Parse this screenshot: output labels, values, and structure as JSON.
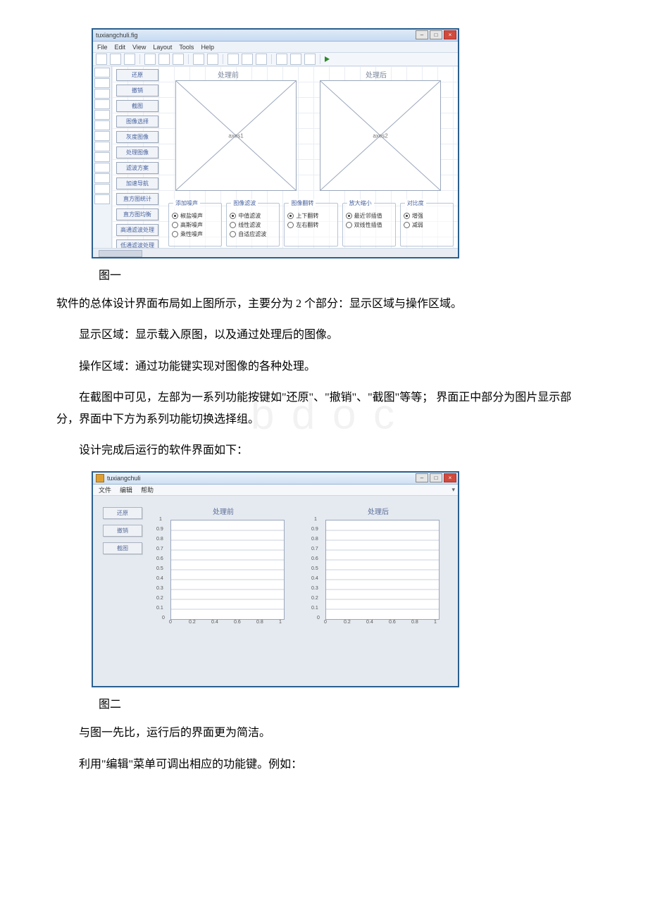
{
  "captions": {
    "fig1": "图一",
    "fig2": "图二"
  },
  "paragraphs": {
    "p1": "软件的总体设计界面布局如上图所示，主要分为 2 个部分：显示区域与操作区域。",
    "p2": "显示区域：显示载入原图，以及通过处理后的图像。",
    "p3": "操作区域：通过功能键实现对图像的各种处理。",
    "p4": "在截图中可见，左部为一系列功能按键如\"还原\"、\"撤销\"、\"截图\"等等； 界面正中部分为图片显示部分，界面中下方为系列功能切换选择组。",
    "p5": "设计完成后运行的软件界面如下：",
    "p6": "与图一先比，运行后的界面更为简洁。",
    "p7": "利用\"编辑\"菜单可调出相应的功能键。例如："
  },
  "fig1": {
    "titlebar": "tuxiangchuli.fig",
    "menus": [
      "File",
      "Edit",
      "View",
      "Layout",
      "Tools",
      "Help"
    ],
    "axes_labels": {
      "left": "处理前",
      "right": "处理后"
    },
    "axes_names": {
      "left": "axes1",
      "right": "axes2"
    },
    "side_buttons": [
      "还原",
      "撤销",
      "截图",
      "图像选择",
      "灰度图像",
      "处理图像",
      "滤波方案",
      "加速导航",
      "直方图统计",
      "直方图均衡",
      "高通滤波处理",
      "低通滤波处理"
    ],
    "groups": {
      "noise": {
        "title": "添加噪声",
        "options": [
          "椒盐噪声",
          "高斯噪声",
          "乘性噪声"
        ]
      },
      "filter": {
        "title": "图像滤波",
        "options": [
          "中值滤波",
          "线性滤波",
          "自适应滤波"
        ]
      },
      "flip": {
        "title": "图像翻转",
        "options": [
          "上下翻转",
          "左右翻转"
        ]
      },
      "zoom": {
        "title": "放大缩小",
        "options": [
          "最近邻插值",
          "双线性插值"
        ]
      },
      "compare": {
        "title": "对比度",
        "options": [
          "增强",
          "减弱"
        ]
      }
    }
  },
  "fig2": {
    "titlebar": "tuxiangchuli",
    "menus": [
      "文件",
      "编辑",
      "帮助"
    ],
    "axes_labels": {
      "left": "处理前",
      "right": "处理后"
    },
    "side_buttons": [
      "还原",
      "撤销",
      "截图"
    ]
  },
  "chart_data": [
    {
      "type": "scatter",
      "title": "处理前",
      "x": [],
      "y": [],
      "xlabel": "",
      "ylabel": "",
      "xlim": [
        0,
        1
      ],
      "ylim": [
        0,
        1
      ],
      "xticks": [
        0,
        0.2,
        0.4,
        0.6,
        0.8,
        1
      ],
      "yticks": [
        0,
        0.1,
        0.2,
        0.3,
        0.4,
        0.5,
        0.6,
        0.7,
        0.8,
        0.9,
        1
      ]
    },
    {
      "type": "scatter",
      "title": "处理后",
      "x": [],
      "y": [],
      "xlabel": "",
      "ylabel": "",
      "xlim": [
        0,
        1
      ],
      "ylim": [
        0,
        1
      ],
      "xticks": [
        0,
        0.2,
        0.4,
        0.6,
        0.8,
        1
      ],
      "yticks": [
        0,
        0.1,
        0.2,
        0.3,
        0.4,
        0.5,
        0.6,
        0.7,
        0.8,
        0.9,
        1
      ]
    }
  ]
}
